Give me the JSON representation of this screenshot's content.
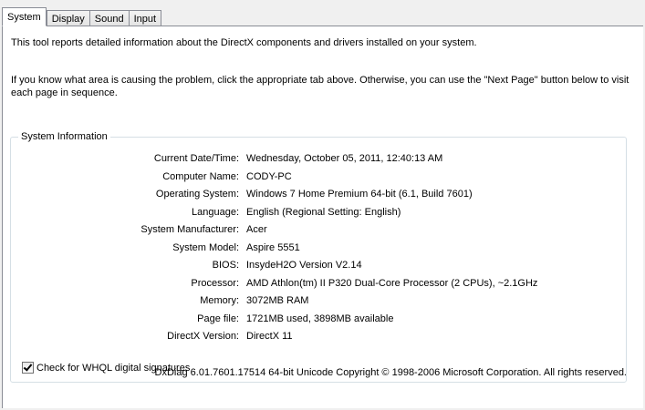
{
  "tabs": [
    {
      "label": "System",
      "active": true
    },
    {
      "label": "Display",
      "active": false
    },
    {
      "label": "Sound",
      "active": false
    },
    {
      "label": "Input",
      "active": false
    }
  ],
  "intro_text": "This tool reports detailed information about the DirectX components and drivers installed on your system.",
  "instructions_text": "If you know what area is causing the problem, click the appropriate tab above.  Otherwise, you can use the \"Next Page\" button below to visit each page in sequence.",
  "system_info": {
    "group_title": "System Information",
    "rows": [
      {
        "label": "Current Date/Time:",
        "value": "Wednesday, October 05, 2011, 12:40:13 AM"
      },
      {
        "label": "Computer Name:",
        "value": "CODY-PC"
      },
      {
        "label": "Operating System:",
        "value": "Windows 7 Home Premium 64-bit (6.1, Build 7601)"
      },
      {
        "label": "Language:",
        "value": "English (Regional Setting: English)"
      },
      {
        "label": "System Manufacturer:",
        "value": "Acer"
      },
      {
        "label": "System Model:",
        "value": "Aspire 5551"
      },
      {
        "label": "BIOS:",
        "value": "InsydeH2O Version V2.14"
      },
      {
        "label": "Processor:",
        "value": "AMD Athlon(tm) II P320 Dual-Core Processor (2 CPUs), ~2.1GHz"
      },
      {
        "label": "Memory:",
        "value": "3072MB RAM"
      },
      {
        "label": "Page file:",
        "value": "1721MB used, 3898MB available"
      },
      {
        "label": "DirectX Version:",
        "value": "DirectX 11"
      }
    ]
  },
  "whql_checkbox": {
    "label": "Check for WHQL digital signatures",
    "checked": true
  },
  "footer_text": "DxDiag 6.01.7601.17514 64-bit Unicode  Copyright © 1998-2006 Microsoft Corporation.  All rights reserved."
}
